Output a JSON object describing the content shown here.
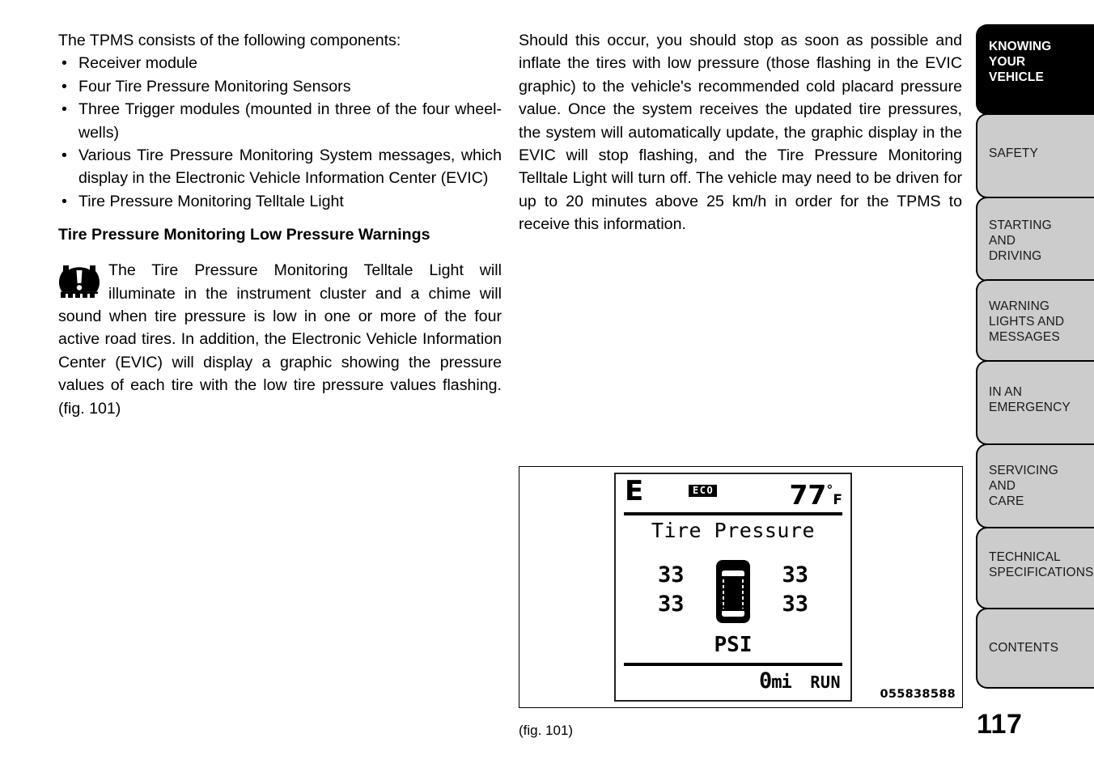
{
  "page": {
    "number": "117"
  },
  "left_column": {
    "intro": "The TPMS consists of the following components:",
    "components": [
      "Receiver module",
      "Four Tire Pressure Monitoring Sensors",
      "Three Trigger modules (mounted in three of the four wheel-wells)",
      "Various Tire Pressure Monitoring System messages, which display in the Electronic Vehicle Information Center (EVIC)",
      "Tire Pressure Monitoring Telltale Light"
    ],
    "subheading": "Tire Pressure Monitoring Low Pressure Warnings",
    "warning_icon": "tpms-telltale-icon",
    "warning_paragraph": "The Tire Pressure Monitoring Telltale Light will illuminate in the instrument cluster and a chime will sound when tire pressure is low in one or more of the four active road tires. In addition, the Electronic Vehicle Information Center (EVIC) will display a graphic showing the pressure values of each tire with the low tire pressure values flashing. (fig. 101)"
  },
  "right_column": {
    "paragraph": "Should this occur, you should stop as soon as possible and inflate the tires with low pressure (those flashing in the EVIC graphic) to the vehicle's recommended cold placard pressure value. Once the system receives the updated tire pressures, the system will automatically update, the graphic display in the EVIC will stop flashing, and the Tire Pressure Monitoring Telltale Light will turn off. The vehicle may need to be driven for up to 20 minutes above 25 km/h in order for the TPMS to receive this information."
  },
  "figure": {
    "caption": "(fig. 101)",
    "image_number": "055838588",
    "evic": {
      "fuel_level": "E",
      "eco_badge": "ECO",
      "temperature": "77",
      "temp_degree": "°",
      "temp_unit": "F",
      "screen_title": "Tire Pressure",
      "tire_front_left": "33",
      "tire_front_right": "33",
      "tire_rear_left": "33",
      "tire_rear_right": "33",
      "pressure_unit": "PSI",
      "odometer_value": "0",
      "odometer_unit": "mi",
      "run_state": "RUN"
    }
  },
  "sidebar": {
    "tabs": [
      {
        "lines": [
          "KNOWING",
          "YOUR",
          "VEHICLE"
        ],
        "active": true
      },
      {
        "lines": [
          "SAFETY"
        ],
        "active": false
      },
      {
        "lines": [
          "STARTING",
          "AND",
          "DRIVING"
        ],
        "active": false
      },
      {
        "lines": [
          "WARNING",
          "LIGHTS AND",
          "MESSAGES"
        ],
        "active": false
      },
      {
        "lines": [
          "IN AN",
          "EMERGENCY"
        ],
        "active": false
      },
      {
        "lines": [
          "SERVICING",
          "AND",
          "CARE"
        ],
        "active": false
      },
      {
        "lines": [
          "TECHNICAL",
          "SPECIFICATIONS"
        ],
        "active": false
      },
      {
        "lines": [
          "CONTENTS"
        ],
        "active": false
      }
    ]
  },
  "colors": {
    "active_tab_bg": "#000000",
    "tab_bg": "#cccccc",
    "text": "#000000"
  }
}
